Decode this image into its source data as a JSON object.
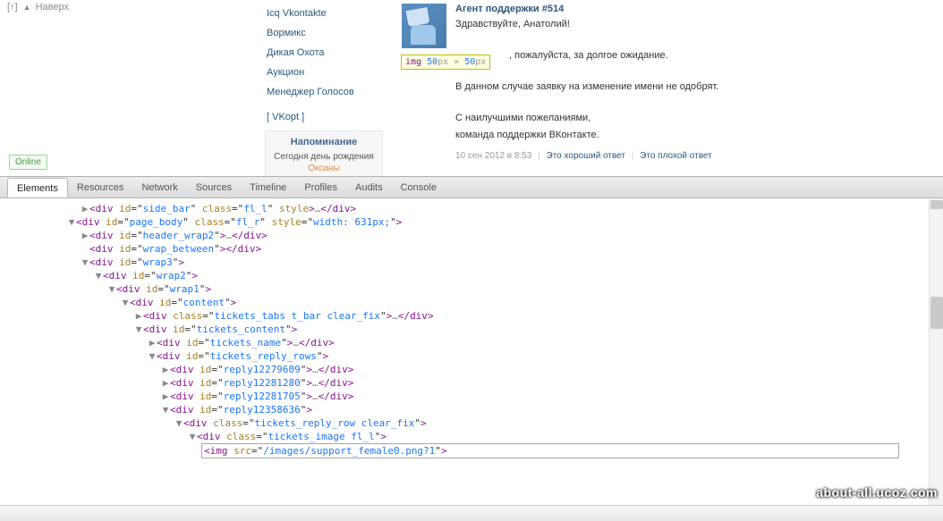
{
  "backToTop": {
    "bracket": "[↑]",
    "label": "Наверх"
  },
  "sidebar": {
    "items": [
      "Icq Vkontakte",
      "Вормикс",
      "Дикая Охота",
      "Аукцион",
      "Менеджер Голосов"
    ],
    "vkopt": "[ VKopt ]"
  },
  "reminder": {
    "title": "Напоминание",
    "text_part1": "Сегодня ",
    "text_part2": "день рождения ",
    "name": "Оксаны"
  },
  "onlineBadge": "Online",
  "chat": {
    "agent": "Агент поддержки #514",
    "line1": "Здравствуйте, Анатолий!",
    "line2_tail": ", пожалуйста, за долгое ожидание.",
    "line3": "В данном случае заявку на изменение имени не одобрят.",
    "line4": "С наилучшими пожеланиями,",
    "line5": "команда поддержки ВКонтакте.",
    "timestamp": "10 сен 2012 в 8:53",
    "good": "Это хороший ответ",
    "bad": "Это плохой ответ"
  },
  "tooltip": {
    "tag": "img",
    "w": "50",
    "h": "50",
    "px1": "px",
    "px2": "px",
    "x": " × "
  },
  "devtools": {
    "tabs": [
      "Elements",
      "Resources",
      "Network",
      "Sources",
      "Timeline",
      "Profiles",
      "Audits",
      "Console"
    ],
    "activeTab": 0,
    "dom": [
      {
        "indent": 6,
        "toggle": "▶",
        "html": "<div id=\"side_bar\" class=\"fl_l\" style>…</div>"
      },
      {
        "indent": 5,
        "toggle": "▼",
        "html": "<div id=\"page_body\" class=\"fl_r\" style=\"width: 631px;\">"
      },
      {
        "indent": 6,
        "toggle": "▶",
        "html": "<div id=\"header_wrap2\">…</div>"
      },
      {
        "indent": 6,
        "toggle": "",
        "html": "<div id=\"wrap_between\"></div>"
      },
      {
        "indent": 6,
        "toggle": "▼",
        "html": "<div id=\"wrap3\">"
      },
      {
        "indent": 7,
        "toggle": "▼",
        "html": "<div id=\"wrap2\">"
      },
      {
        "indent": 8,
        "toggle": "▼",
        "html": "<div id=\"wrap1\">"
      },
      {
        "indent": 9,
        "toggle": "▼",
        "html": "<div id=\"content\">"
      },
      {
        "indent": 10,
        "toggle": "▶",
        "html": "<div class=\"tickets_tabs t_bar clear_fix\">…</div>"
      },
      {
        "indent": 10,
        "toggle": "▼",
        "html": "<div id=\"tickets_content\">"
      },
      {
        "indent": 11,
        "toggle": "▶",
        "html": "<div id=\"tickets_name\">…</div>"
      },
      {
        "indent": 11,
        "toggle": "▼",
        "html": "<div id=\"tickets_reply_rows\">"
      },
      {
        "indent": 12,
        "toggle": "▶",
        "html": "<div id=\"reply12279609\">…</div>"
      },
      {
        "indent": 12,
        "toggle": "▶",
        "html": "<div id=\"reply12281280\">…</div>"
      },
      {
        "indent": 12,
        "toggle": "▶",
        "html": "<div id=\"reply12281705\">…</div>"
      },
      {
        "indent": 12,
        "toggle": "▼",
        "html": "<div id=\"reply12358636\">"
      },
      {
        "indent": 13,
        "toggle": "▼",
        "html": "<div class=\"tickets_reply_row clear_fix\">"
      },
      {
        "indent": 14,
        "toggle": "▼",
        "html": "<div class=\"tickets_image fl_l\">"
      }
    ],
    "editing": "<img src=\"/images/support_female0.png?1\">",
    "editingIndent": 15
  },
  "watermark": "about-all.ucoz.com"
}
